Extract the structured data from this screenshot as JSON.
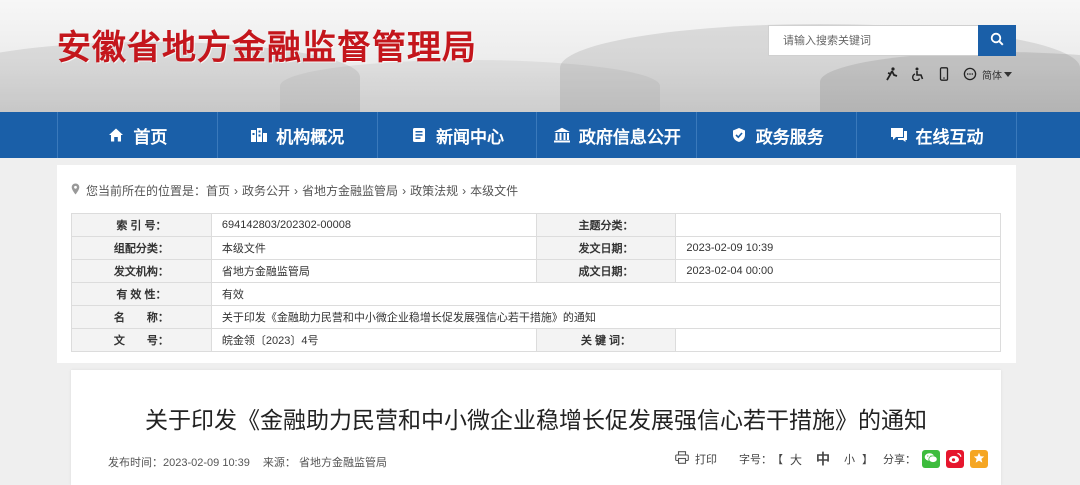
{
  "header": {
    "site_title": "安徽省地方金融监督管理局",
    "search_placeholder": "请输入搜索关键词",
    "lang_label": "简体",
    "colors": {
      "title": "#c4161c",
      "nav": "#1a5fa8"
    }
  },
  "icons": [
    "search-icon",
    "elderly-mode-icon",
    "accessibility-icon",
    "mobile-icon",
    "chat-icon",
    "home-icon",
    "building-icon",
    "news-icon",
    "government-icon",
    "service-icon",
    "interaction-icon",
    "location-icon",
    "print-icon",
    "wechat-icon",
    "weibo-icon",
    "favorite-icon"
  ],
  "nav": {
    "items": [
      {
        "label": "首页",
        "icon": "home-icon"
      },
      {
        "label": "机构概况",
        "icon": "building-icon"
      },
      {
        "label": "新闻中心",
        "icon": "news-icon"
      },
      {
        "label": "政府信息公开",
        "icon": "government-icon"
      },
      {
        "label": "政务服务",
        "icon": "service-icon"
      },
      {
        "label": "在线互动",
        "icon": "interaction-icon"
      }
    ]
  },
  "breadcrumb": {
    "prefix": "您当前所在的位置是：",
    "items": [
      "首页",
      "政务公开",
      "省地方金融监管局",
      "政策法规",
      "本级文件"
    ],
    "sep": "›"
  },
  "meta": {
    "index_label": "索 引 号：",
    "index_value": "694142803/202302-00008",
    "topic_label": "主题分类：",
    "topic_value": "",
    "category_label": "组配分类：",
    "category_value": "本级文件",
    "issue_date_label": "发文日期：",
    "issue_date_value": "2023-02-09 10:39",
    "org_label": "发文机构：",
    "org_value": "省地方金融监管局",
    "made_date_label": "成文日期：",
    "made_date_value": "2023-02-04 00:00",
    "validity_label": "有 效 性：",
    "validity_value": "有效",
    "name_label": "名　　称：",
    "name_value": "关于印发《金融助力民营和中小微企业稳增长促发展强信心若干措施》的通知",
    "docno_label": "文　　号：",
    "docno_value": "皖金领〔2023〕4号",
    "keywords_label": "关 键 词：",
    "keywords_value": ""
  },
  "article": {
    "title": "关于印发《金融助力民营和中小微企业稳增长促发展强信心若干措施》的通知",
    "publish_time": "发布时间：2023-02-09 10:39",
    "source": "来源： 省地方金融监管局",
    "print_label": "打印",
    "fontsize_label": "字号：",
    "bracket_open": "【",
    "bracket_close": "】",
    "size_large": "大",
    "size_medium": "中",
    "size_small": "小",
    "share_label": "分享："
  }
}
